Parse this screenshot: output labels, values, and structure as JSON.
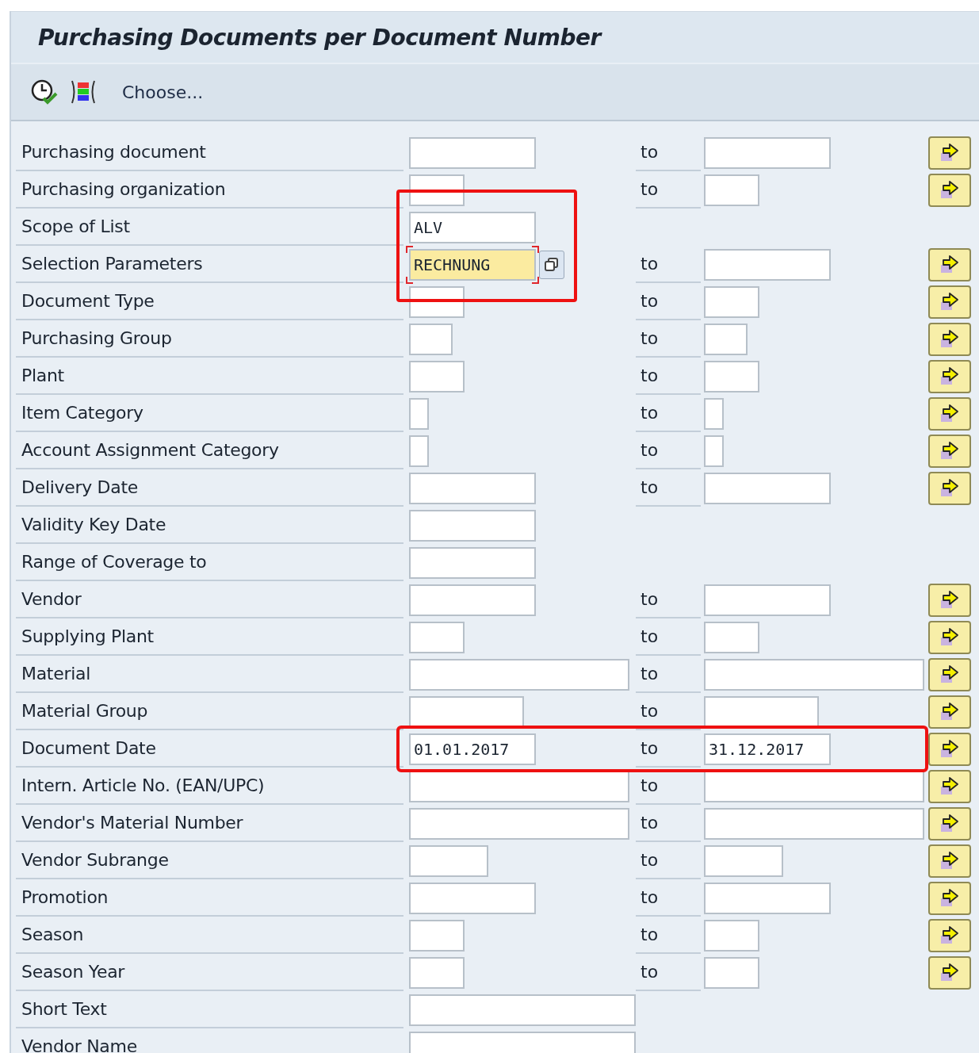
{
  "title": "Purchasing Documents per Document Number",
  "toolbar": {
    "choose_label": "Choose..."
  },
  "rows": [
    {
      "label": "Purchasing document",
      "kind": "range",
      "to": "to",
      "multiple": true
    },
    {
      "label": "Purchasing organization",
      "kind": "range",
      "to": "to",
      "multiple": true
    },
    {
      "label": "Scope of List",
      "kind": "single",
      "low_value": "ALV",
      "highlight_low": true
    },
    {
      "label": "Selection Parameters",
      "kind": "range",
      "low_value": "RECHNUNG",
      "low_focused": true,
      "to": "to",
      "multiple": true,
      "highlight_low": true
    },
    {
      "label": "Document Type",
      "kind": "range",
      "to": "to",
      "multiple": true
    },
    {
      "label": "Purchasing Group",
      "kind": "range",
      "to": "to",
      "multiple": true
    },
    {
      "label": "Plant",
      "kind": "range",
      "to": "to",
      "multiple": true
    },
    {
      "label": "Item Category",
      "kind": "range",
      "to": "to",
      "multiple": true
    },
    {
      "label": "Account Assignment Category",
      "kind": "range",
      "to": "to",
      "multiple": true
    },
    {
      "label": "Delivery Date",
      "kind": "range",
      "to": "to",
      "multiple": true
    },
    {
      "label": "Validity Key Date",
      "kind": "single"
    },
    {
      "label": "Range of Coverage to",
      "kind": "single"
    },
    {
      "label": "Vendor",
      "kind": "range",
      "to": "to",
      "multiple": true
    },
    {
      "label": "Supplying Plant",
      "kind": "range",
      "to": "to",
      "multiple": true
    },
    {
      "label": "Material",
      "kind": "range",
      "to": "to",
      "multiple": true
    },
    {
      "label": "Material Group",
      "kind": "range",
      "to": "to",
      "multiple": true
    },
    {
      "label": "Document Date",
      "kind": "range",
      "low_value": "01.01.2017",
      "to": "to",
      "high_value": "31.12.2017",
      "multiple": true,
      "highlight_range": true
    },
    {
      "label": "Intern. Article No. (EAN/UPC)",
      "kind": "range",
      "to": "to",
      "multiple": true
    },
    {
      "label": "Vendor's Material Number",
      "kind": "range",
      "to": "to",
      "multiple": true
    },
    {
      "label": "Vendor Subrange",
      "kind": "range",
      "to": "to",
      "multiple": true
    },
    {
      "label": "Promotion",
      "kind": "range",
      "to": "to",
      "multiple": true
    },
    {
      "label": "Season",
      "kind": "range",
      "to": "to",
      "multiple": true
    },
    {
      "label": "Season Year",
      "kind": "range",
      "to": "to",
      "multiple": true
    },
    {
      "label": "Short Text",
      "kind": "single"
    },
    {
      "label": "Vendor Name",
      "kind": "single"
    }
  ]
}
